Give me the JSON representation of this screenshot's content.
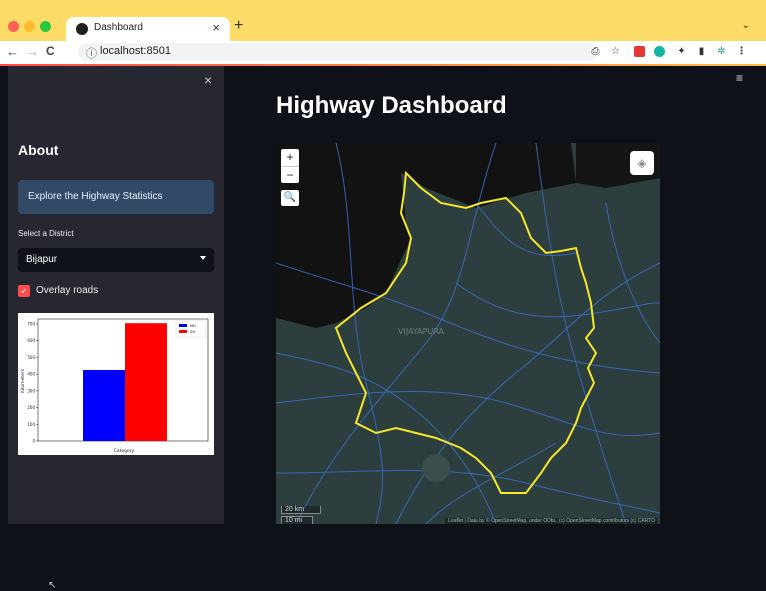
{
  "browser": {
    "tab_title": "Dashboard",
    "tab_close": "×",
    "new_tab": "+",
    "tab_menu": "⌄",
    "url": "localhost:8501",
    "nav_back": "←",
    "nav_forward": "→",
    "nav_reload": "C",
    "info_glyph": "ⓘ",
    "toolbar_icons": [
      "⎙",
      "☆",
      "",
      "",
      "✦",
      "▮",
      "✲",
      "⋮"
    ]
  },
  "sidebar": {
    "close_glyph": "×",
    "about_title": "About",
    "info_text": "Explore the Highway Statistics",
    "select_label": "Select a District",
    "selected_district": "Bijapur",
    "overlay_label": "Overlay roads",
    "overlay_checked": true
  },
  "main": {
    "menu_glyph": "≡",
    "title": "Highway Dashboard"
  },
  "map": {
    "zoom_in": "+",
    "zoom_out": "−",
    "district_label": "VIJAYAPURA",
    "scale_km": "20 km",
    "scale_mi": "10 mi",
    "attribution": "Leaflet | Data by © OpenStreetMap, under ODbL. (c) OpenStreetMap contributors (c) CARTO",
    "boundary_color": "#f5e72a",
    "road_color": "#3b6fd0"
  },
  "chart_data": {
    "type": "bar",
    "categories": [
      "NH",
      "SH"
    ],
    "series": [
      {
        "name": "NH",
        "values": [
          425
        ],
        "color": "#0000ff"
      },
      {
        "name": "SH",
        "values": [
          705
        ],
        "color": "#ff0000"
      }
    ],
    "xlabel": "Category",
    "ylabel": "Kilometers",
    "ylim": [
      0,
      730
    ],
    "yticks": [
      0,
      100,
      200,
      300,
      400,
      500,
      600,
      700
    ],
    "legend_position": "top-right"
  }
}
